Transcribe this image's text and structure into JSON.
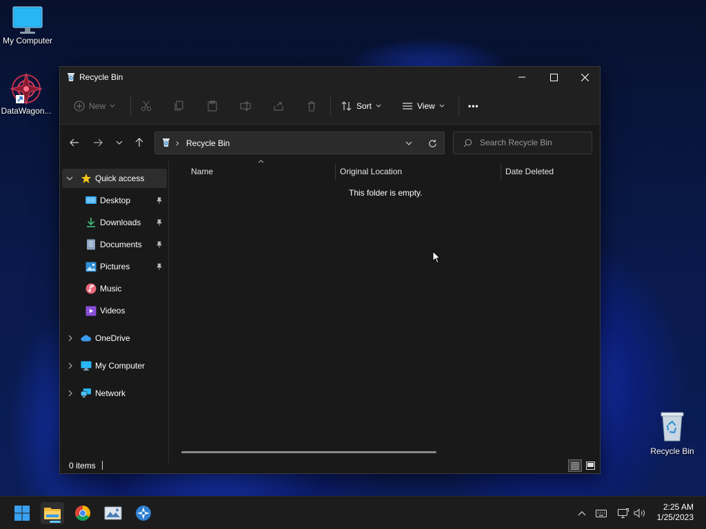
{
  "desktop": {
    "icons": [
      {
        "label": "My Computer",
        "icon": "monitor-icon"
      },
      {
        "label": "DataWagon...",
        "icon": "datawagon-app-icon"
      },
      {
        "label": "Recycle Bin",
        "icon": "recycle-bin-icon"
      }
    ]
  },
  "window": {
    "title": "Recycle Bin",
    "toolbar": {
      "new_label": "New",
      "sort_label": "Sort",
      "view_label": "View",
      "more_label": "•••"
    },
    "address": {
      "separator": "›",
      "location": "Recycle Bin"
    },
    "search": {
      "placeholder": "Search Recycle Bin"
    },
    "sidebar": {
      "quick_access": "Quick access",
      "items": [
        {
          "label": "Desktop",
          "icon": "desktop-folder-icon",
          "pinned": true
        },
        {
          "label": "Downloads",
          "icon": "download-icon",
          "pinned": true
        },
        {
          "label": "Documents",
          "icon": "document-icon",
          "pinned": true
        },
        {
          "label": "Pictures",
          "icon": "pictures-icon",
          "pinned": true
        },
        {
          "label": "Music",
          "icon": "music-icon",
          "pinned": false
        },
        {
          "label": "Videos",
          "icon": "video-icon",
          "pinned": false
        }
      ],
      "onedrive": "OneDrive",
      "my_computer": "My Computer",
      "network": "Network"
    },
    "columns": {
      "name": "Name",
      "original_location": "Original Location",
      "date_deleted": "Date Deleted"
    },
    "empty_message": "This folder is empty.",
    "status": {
      "items": "0 items"
    }
  },
  "taskbar": {
    "apps": [
      "windows-start-icon",
      "file-explorer-icon",
      "chrome-icon",
      "image-viewer-icon",
      "app-icon"
    ],
    "clock": {
      "time": "2:25 AM",
      "date": "1/25/2023"
    }
  },
  "colors": {
    "accent": "#60cdff",
    "window_bg": "#191919",
    "titlebar_bg": "#202020",
    "taskbar_bg": "#1c1c1c"
  }
}
